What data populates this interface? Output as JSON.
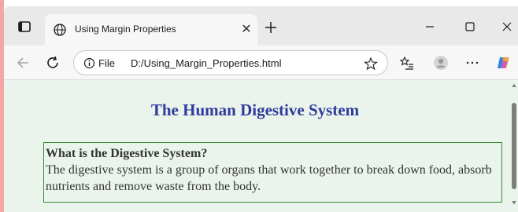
{
  "browser": {
    "tab": {
      "title": "Using Margin Properties"
    },
    "address": {
      "scheme": "File",
      "url": "D:/Using_Margin_Properties.html"
    }
  },
  "page": {
    "title": "The Human Digestive System",
    "section": {
      "heading": "What is the Digestive System?",
      "body": "The digestive system is a group of organs that work together to break down food, absorb nutrients and remove waste from the body."
    }
  },
  "colors": {
    "page_background": "#ebf4ec",
    "title_color": "#2f3b9d",
    "card_border": "#3a8a3a"
  },
  "icons": [
    "sidebar-icon",
    "globe-icon",
    "close-icon",
    "plus-icon",
    "minimize-icon",
    "maximize-icon",
    "window-close-icon",
    "back-icon",
    "reload-icon",
    "info-icon",
    "star-icon",
    "favorites-icon",
    "profile-icon",
    "more-icon",
    "copilot-icon"
  ]
}
